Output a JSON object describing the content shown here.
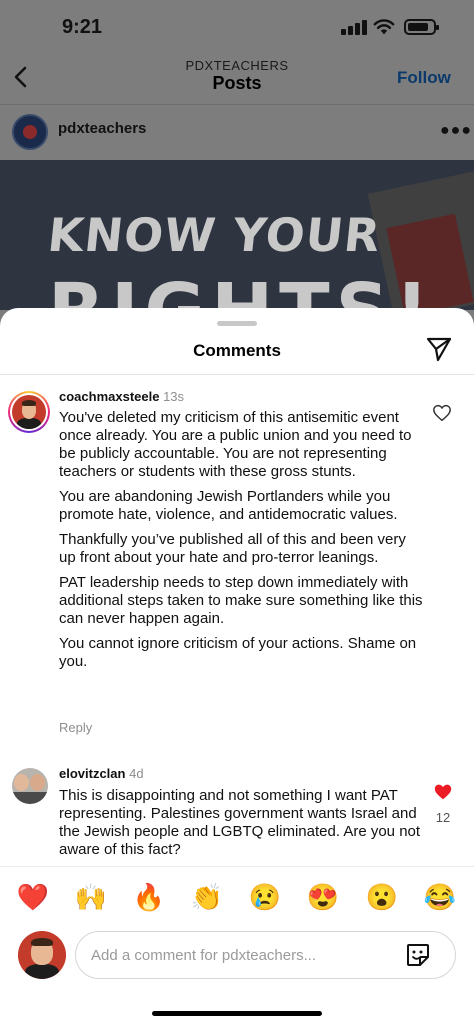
{
  "status_bar": {
    "time": "9:21"
  },
  "nav": {
    "account": "PDXTEACHERS",
    "title": "Posts",
    "follow_label": "Follow"
  },
  "post": {
    "username": "pdxteachers",
    "image_text_line1": "KNOW YOUR",
    "image_text_line2": "RIGHTS!"
  },
  "comments_sheet": {
    "title": "Comments",
    "comments": [
      {
        "username": "coachmaxsteele",
        "time": "13s",
        "paragraphs": [
          "You've deleted my criticism of this antisemitic event once already. You are a public union and you need to be publicly accountable. You are not representing teachers or students with these gross stunts.",
          "You are abandoning Jewish Portlanders while you promote hate, violence, and antidemocratic values.",
          "Thankfully you’ve published all of this and been very up front about your hate and pro-terror leanings.",
          "PAT leadership needs to step down immediately with additional steps taken to make sure something like this can never happen again.",
          "You cannot ignore criticism of your actions. Shame on you."
        ],
        "reply_label": "Reply",
        "liked": false
      },
      {
        "username": "elovitzclan",
        "time": "4d",
        "text": "This is disappointing and not something I want PAT representing. Palestines government wants Israel and the Jewish people and LGBTQ eliminated. Are you not aware of this fact?",
        "likes": "12",
        "liked": true
      }
    ],
    "emoji_reactions": [
      "❤️",
      "🙌",
      "🔥",
      "👏",
      "😢",
      "😍",
      "😮",
      "😂"
    ],
    "input": {
      "placeholder": "Add a comment for pdxteachers..."
    }
  },
  "colors": {
    "follow_blue": "#0a3a6b",
    "like_red": "#ed1c24",
    "muted_text": "#8e8e8e",
    "dim_overlay": "#7d7d7d"
  },
  "icons": [
    "back-chevron-icon",
    "more-icon",
    "share-send-icon",
    "heart-outline-icon",
    "heart-filled-icon",
    "sticker-icon"
  ]
}
